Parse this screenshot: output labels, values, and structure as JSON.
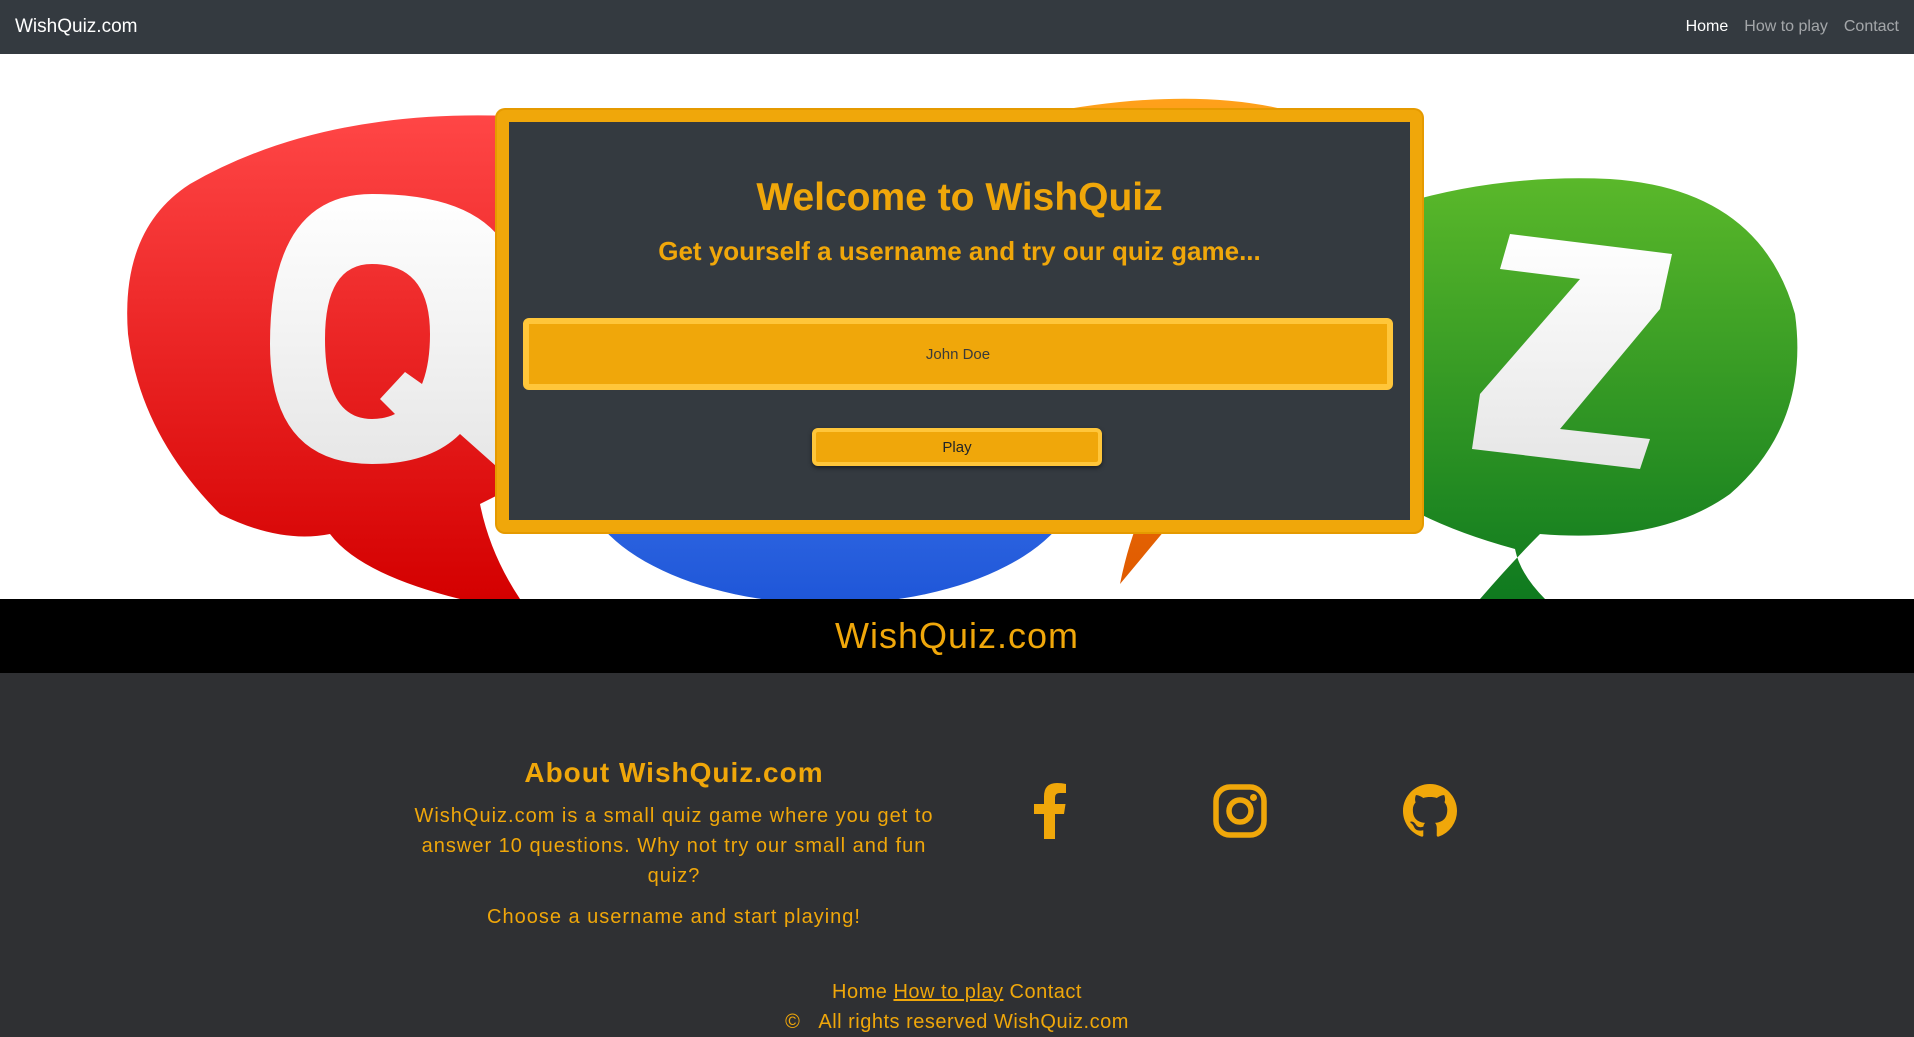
{
  "navbar": {
    "brand": "WishQuiz.com",
    "links": [
      {
        "label": "Home",
        "active": true
      },
      {
        "label": "How to play",
        "active": false
      },
      {
        "label": "Contact",
        "active": false
      }
    ]
  },
  "hero": {
    "background_letters": [
      "Q",
      "Z"
    ],
    "title": "Welcome to WishQuiz",
    "subtitle": "Get yourself a username and try our quiz game...",
    "username_placeholder": "John Doe",
    "play_label": "Play"
  },
  "banner": {
    "title": "WishQuiz.com"
  },
  "footer": {
    "about_title": "About WishQuiz.com",
    "about_text": "WishQuiz.com is a small quiz game where you get to answer 10 questions. Why not try our small and fun quiz?",
    "about_cta": "Choose a username and start playing!",
    "social_icons": [
      "facebook-icon",
      "instagram-icon",
      "github-icon"
    ],
    "links": [
      "Home",
      "How to play",
      "Contact"
    ],
    "copyright_symbol": "©",
    "copyright_text": "All rights reserved WishQuiz.com"
  },
  "colors": {
    "accent": "#f0a70a",
    "navbar": "#343a40",
    "footer": "#2f3033",
    "banner": "#000000"
  }
}
